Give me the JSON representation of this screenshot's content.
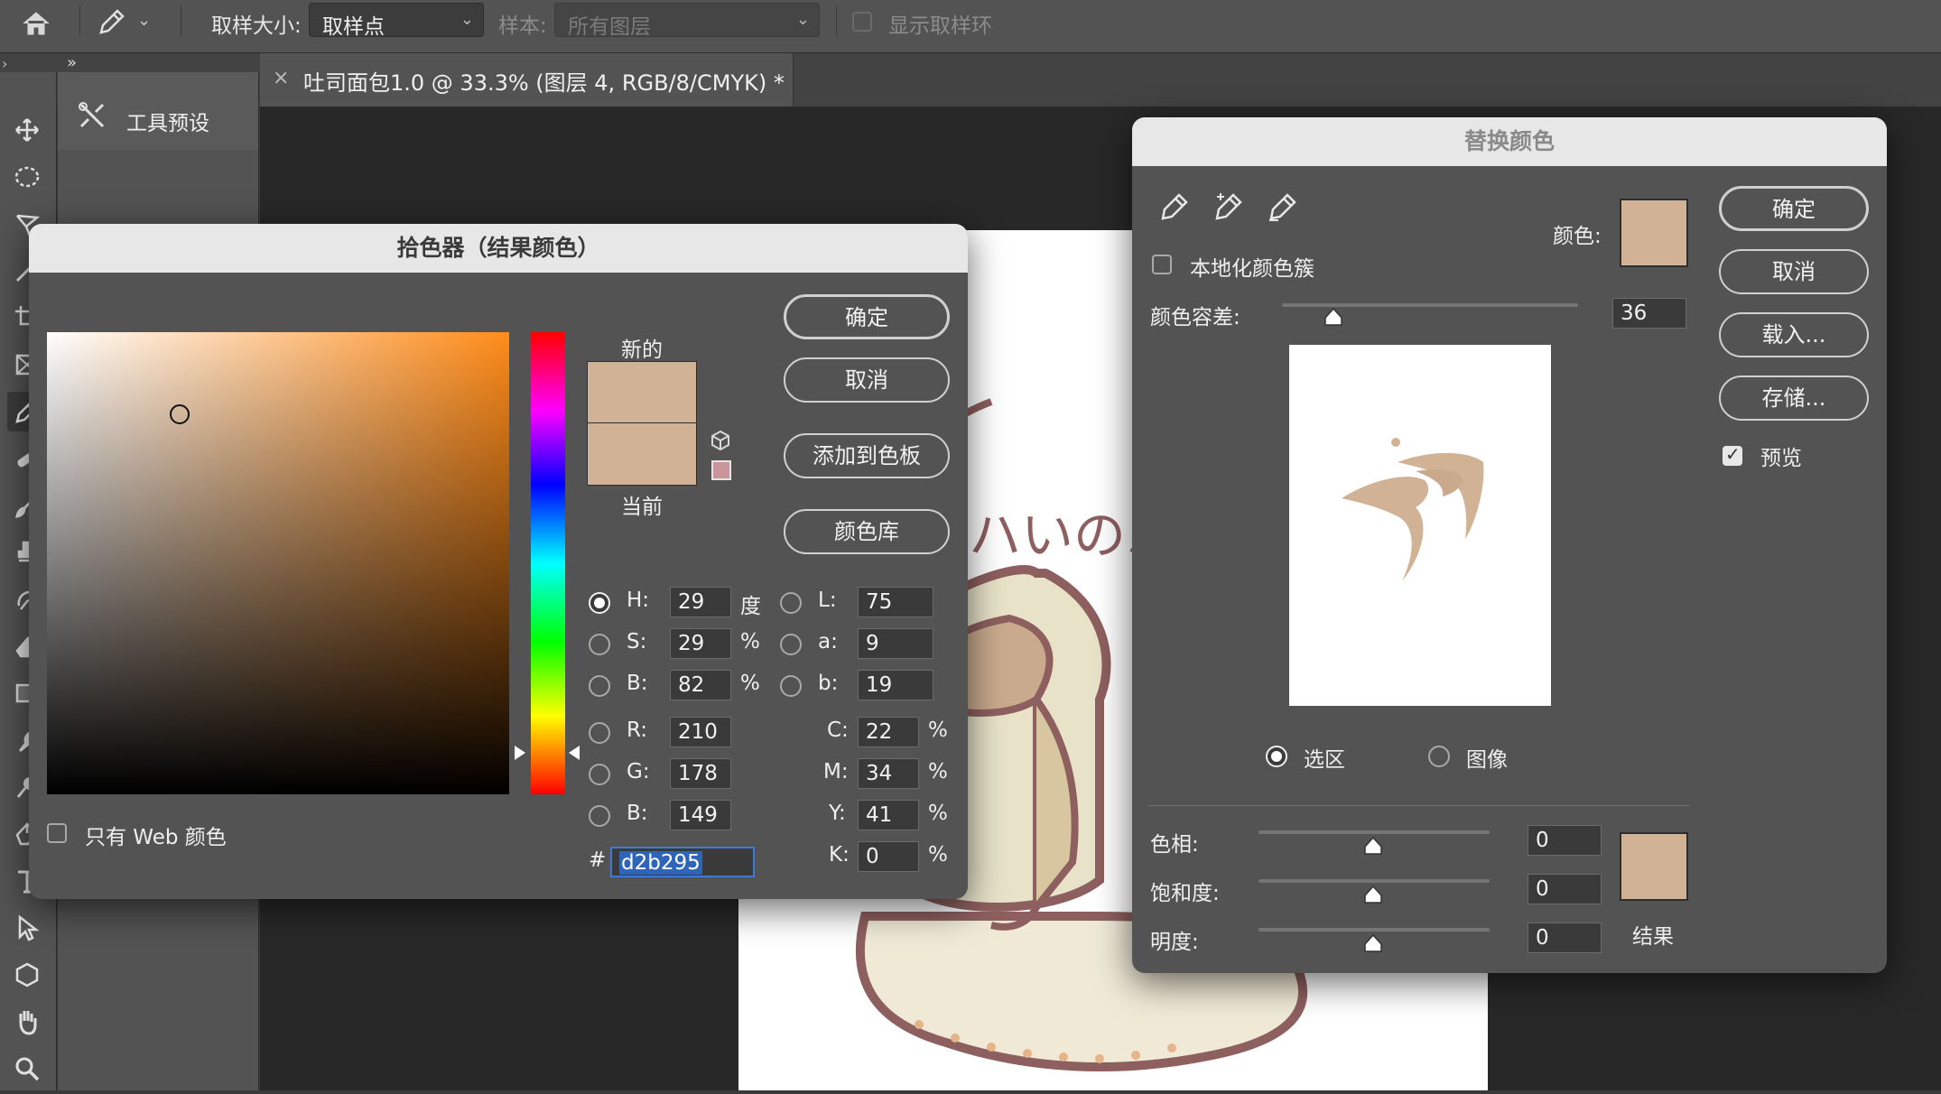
{
  "options_bar": {
    "sample_size_label": "取样大小:",
    "sample_size_value": "取样点",
    "sample_label": "样本:",
    "sample_value": "所有图层",
    "show_ring_label": "显示取样环"
  },
  "document_tab": {
    "title": "吐司面包1.0 @ 33.3% (图层 4, RGB/8/CMYK) *",
    "close_glyph": "×"
  },
  "panel": {
    "title": "工具预设"
  },
  "color_picker": {
    "title": "拾色器（结果颜色）",
    "new_label": "新的",
    "current_label": "当前",
    "new_color": "#d2b295",
    "current_color": "#d2b295",
    "gamut_color": "#c9959a",
    "buttons": {
      "ok": "确定",
      "cancel": "取消",
      "add_swatch": "添加到色板",
      "color_libraries": "颜色库"
    },
    "web_only_label": "只有 Web 颜色",
    "hsb": [
      {
        "label": "H:",
        "value": "29",
        "unit": "度",
        "selected": true
      },
      {
        "label": "S:",
        "value": "29",
        "unit": "%",
        "selected": false
      },
      {
        "label": "B:",
        "value": "82",
        "unit": "%",
        "selected": false
      }
    ],
    "rgb": [
      {
        "label": "R:",
        "value": "210"
      },
      {
        "label": "G:",
        "value": "178"
      },
      {
        "label": "B:",
        "value": "149"
      }
    ],
    "lab": [
      {
        "label": "L:",
        "value": "75"
      },
      {
        "label": "a:",
        "value": "9"
      },
      {
        "label": "b:",
        "value": "19"
      }
    ],
    "cmyk": [
      {
        "label": "C:",
        "value": "22",
        "unit": "%"
      },
      {
        "label": "M:",
        "value": "34",
        "unit": "%"
      },
      {
        "label": "Y:",
        "value": "41",
        "unit": "%"
      },
      {
        "label": "K:",
        "value": "0",
        "unit": "%"
      }
    ],
    "hex_label": "#",
    "hex_value": "d2b295",
    "hue_color": "#ff8c1a"
  },
  "replace_color": {
    "title": "替换颜色",
    "color_label": "颜色:",
    "color_value": "#d2b295",
    "localized_label": "本地化颜色簇",
    "fuzziness_label": "颜色容差:",
    "fuzziness_value": "36",
    "fuzziness_level": 0.18,
    "selection_label": "选区",
    "image_label": "图像",
    "buttons": {
      "ok": "确定",
      "cancel": "取消",
      "load": "载入...",
      "save": "存储..."
    },
    "preview_label": "预览",
    "hue_label": "色相:",
    "hue_value": "0",
    "saturation_label": "饱和度:",
    "saturation_value": "0",
    "lightness_label": "明度:",
    "lightness_value": "0",
    "result_label": "结果",
    "result_color": "#d2b295"
  }
}
